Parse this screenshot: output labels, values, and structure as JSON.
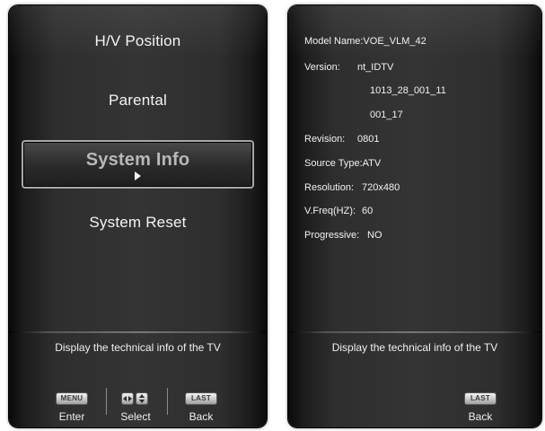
{
  "left_panel": {
    "menu_items": [
      {
        "label": "H/V Position"
      },
      {
        "label": "Parental"
      },
      {
        "label": "System Info"
      },
      {
        "label": "System Reset"
      }
    ],
    "selected_index": 2,
    "help_text": "Display the technical info of the TV",
    "buttons": {
      "menu_chip": "MENU",
      "enter_label": "Enter",
      "select_label": "Select",
      "last_chip": "LAST",
      "back_label": "Back"
    }
  },
  "right_panel": {
    "info": {
      "model_name_label": "Model Name:",
      "model_name_value": "VOE_VLM_42",
      "version_label": "Version:",
      "version_line1": "nt_IDTV",
      "version_line2": "1013_28_001_11",
      "version_line3": "001_17",
      "revision_label": "Revision:",
      "revision_value": "0801",
      "source_type_label": "Source Type:",
      "source_type_value": "ATV",
      "resolution_label": "Resolution:",
      "resolution_value": "720x480",
      "vfreq_label": "V.Freq(HZ):",
      "vfreq_value": "60",
      "progressive_label": "Progressive:",
      "progressive_value": "NO"
    },
    "help_text": "Display the technical info of the TV",
    "buttons": {
      "last_chip": "LAST",
      "back_label": "Back"
    }
  },
  "colors": {
    "panel_bg": "#2e2e2e",
    "text": "#f4f4f4",
    "selected_text": "#b8b8b8",
    "selected_border": "#a8a8a8"
  }
}
